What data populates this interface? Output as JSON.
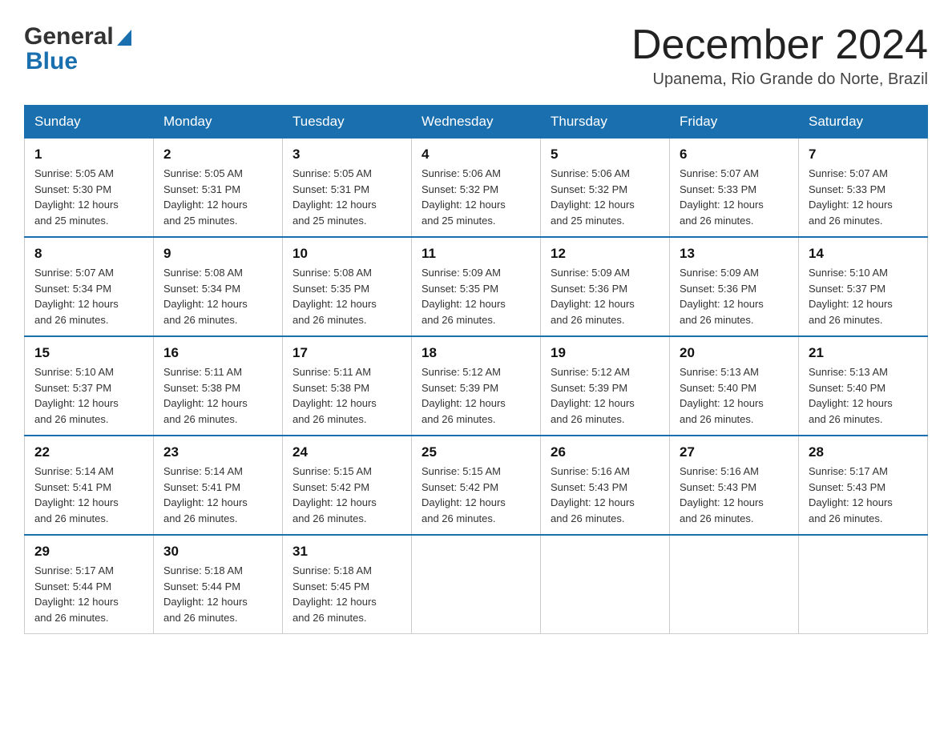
{
  "header": {
    "logo_general": "General",
    "logo_blue": "Blue",
    "month_title": "December 2024",
    "location": "Upanema, Rio Grande do Norte, Brazil"
  },
  "weekdays": [
    "Sunday",
    "Monday",
    "Tuesday",
    "Wednesday",
    "Thursday",
    "Friday",
    "Saturday"
  ],
  "weeks": [
    [
      {
        "day": "1",
        "sunrise": "5:05 AM",
        "sunset": "5:30 PM",
        "daylight": "12 hours and 25 minutes."
      },
      {
        "day": "2",
        "sunrise": "5:05 AM",
        "sunset": "5:31 PM",
        "daylight": "12 hours and 25 minutes."
      },
      {
        "day": "3",
        "sunrise": "5:05 AM",
        "sunset": "5:31 PM",
        "daylight": "12 hours and 25 minutes."
      },
      {
        "day": "4",
        "sunrise": "5:06 AM",
        "sunset": "5:32 PM",
        "daylight": "12 hours and 25 minutes."
      },
      {
        "day": "5",
        "sunrise": "5:06 AM",
        "sunset": "5:32 PM",
        "daylight": "12 hours and 25 minutes."
      },
      {
        "day": "6",
        "sunrise": "5:07 AM",
        "sunset": "5:33 PM",
        "daylight": "12 hours and 26 minutes."
      },
      {
        "day": "7",
        "sunrise": "5:07 AM",
        "sunset": "5:33 PM",
        "daylight": "12 hours and 26 minutes."
      }
    ],
    [
      {
        "day": "8",
        "sunrise": "5:07 AM",
        "sunset": "5:34 PM",
        "daylight": "12 hours and 26 minutes."
      },
      {
        "day": "9",
        "sunrise": "5:08 AM",
        "sunset": "5:34 PM",
        "daylight": "12 hours and 26 minutes."
      },
      {
        "day": "10",
        "sunrise": "5:08 AM",
        "sunset": "5:35 PM",
        "daylight": "12 hours and 26 minutes."
      },
      {
        "day": "11",
        "sunrise": "5:09 AM",
        "sunset": "5:35 PM",
        "daylight": "12 hours and 26 minutes."
      },
      {
        "day": "12",
        "sunrise": "5:09 AM",
        "sunset": "5:36 PM",
        "daylight": "12 hours and 26 minutes."
      },
      {
        "day": "13",
        "sunrise": "5:09 AM",
        "sunset": "5:36 PM",
        "daylight": "12 hours and 26 minutes."
      },
      {
        "day": "14",
        "sunrise": "5:10 AM",
        "sunset": "5:37 PM",
        "daylight": "12 hours and 26 minutes."
      }
    ],
    [
      {
        "day": "15",
        "sunrise": "5:10 AM",
        "sunset": "5:37 PM",
        "daylight": "12 hours and 26 minutes."
      },
      {
        "day": "16",
        "sunrise": "5:11 AM",
        "sunset": "5:38 PM",
        "daylight": "12 hours and 26 minutes."
      },
      {
        "day": "17",
        "sunrise": "5:11 AM",
        "sunset": "5:38 PM",
        "daylight": "12 hours and 26 minutes."
      },
      {
        "day": "18",
        "sunrise": "5:12 AM",
        "sunset": "5:39 PM",
        "daylight": "12 hours and 26 minutes."
      },
      {
        "day": "19",
        "sunrise": "5:12 AM",
        "sunset": "5:39 PM",
        "daylight": "12 hours and 26 minutes."
      },
      {
        "day": "20",
        "sunrise": "5:13 AM",
        "sunset": "5:40 PM",
        "daylight": "12 hours and 26 minutes."
      },
      {
        "day": "21",
        "sunrise": "5:13 AM",
        "sunset": "5:40 PM",
        "daylight": "12 hours and 26 minutes."
      }
    ],
    [
      {
        "day": "22",
        "sunrise": "5:14 AM",
        "sunset": "5:41 PM",
        "daylight": "12 hours and 26 minutes."
      },
      {
        "day": "23",
        "sunrise": "5:14 AM",
        "sunset": "5:41 PM",
        "daylight": "12 hours and 26 minutes."
      },
      {
        "day": "24",
        "sunrise": "5:15 AM",
        "sunset": "5:42 PM",
        "daylight": "12 hours and 26 minutes."
      },
      {
        "day": "25",
        "sunrise": "5:15 AM",
        "sunset": "5:42 PM",
        "daylight": "12 hours and 26 minutes."
      },
      {
        "day": "26",
        "sunrise": "5:16 AM",
        "sunset": "5:43 PM",
        "daylight": "12 hours and 26 minutes."
      },
      {
        "day": "27",
        "sunrise": "5:16 AM",
        "sunset": "5:43 PM",
        "daylight": "12 hours and 26 minutes."
      },
      {
        "day": "28",
        "sunrise": "5:17 AM",
        "sunset": "5:43 PM",
        "daylight": "12 hours and 26 minutes."
      }
    ],
    [
      {
        "day": "29",
        "sunrise": "5:17 AM",
        "sunset": "5:44 PM",
        "daylight": "12 hours and 26 minutes."
      },
      {
        "day": "30",
        "sunrise": "5:18 AM",
        "sunset": "5:44 PM",
        "daylight": "12 hours and 26 minutes."
      },
      {
        "day": "31",
        "sunrise": "5:18 AM",
        "sunset": "5:45 PM",
        "daylight": "12 hours and 26 minutes."
      },
      null,
      null,
      null,
      null
    ]
  ]
}
